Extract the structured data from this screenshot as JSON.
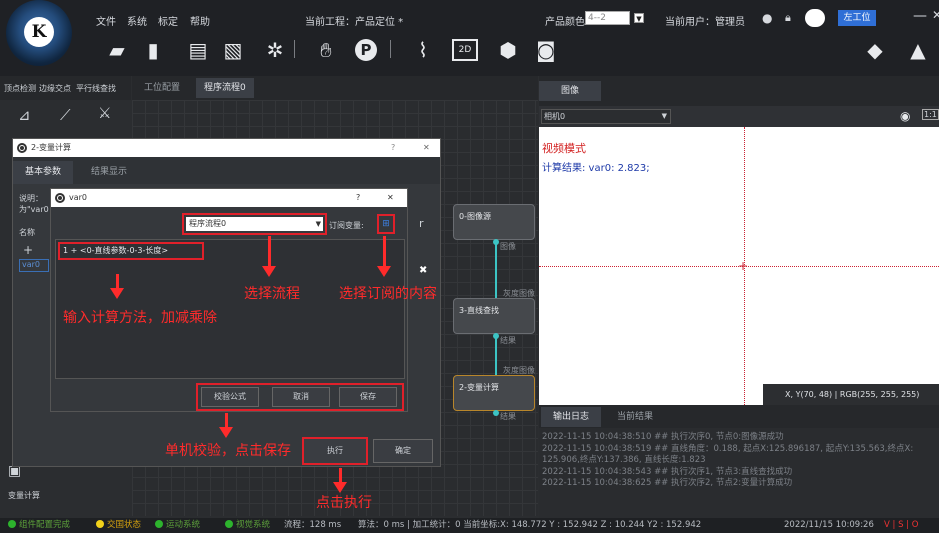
{
  "menu": {
    "file": "文件",
    "system": "系统",
    "calibrate": "标定",
    "help": "帮助",
    "project": "当前工程：产品定位 *",
    "product_color_label": "产品颜色",
    "product_color_value": "4--2",
    "user": "当前用户：管理员",
    "station": "左工位"
  },
  "left_tabs": [
    "顶点检测",
    "边缘交点",
    "平行线查找"
  ],
  "center_tabs": [
    "工位配置",
    "程序流程0"
  ],
  "image_tab": "图像",
  "camera_select": "相机0",
  "image_overlay": {
    "mode": "视频模式",
    "result": "计算结果: var0: 2.823;"
  },
  "coord_readout": "X, Y(70, 48)  |  RGB(255, 255, 255)",
  "log_tabs": [
    "输出日志",
    "当前结果"
  ],
  "log_lines": [
    "2022-11-15 10:04:38:510 ## 执行次序0, 节点0:图像源成功",
    "2022-11-15 10:04:38:519 ## 直线角度：0.188, 起点X:125.896187, 起点Y:135.563,终点X:",
    "125.906,终点Y:137.386, 直线长度:1.823",
    "2022-11-15 10:04:38:543 ## 执行次序1, 节点3:直线查找成功",
    "2022-11-15 10:04:38:625 ## 执行次序2, 节点2:变量计算成功"
  ],
  "nodes": {
    "n0": "0-图像源",
    "n0_port": "图像",
    "n3_in": "灰度图像",
    "n3": "3-直线查找",
    "n3_port": "结果",
    "n2_in": "灰度图像",
    "n2": "2-变量计算",
    "n2_port": "结果"
  },
  "side": {
    "var_calc": "变量计算"
  },
  "dlg1": {
    "title": "2-变量计算",
    "help": "?",
    "close": "✕",
    "tab_basic": "基本参数",
    "tab_result": "结果显示",
    "desc_label": "说明：",
    "name_label": "名称",
    "add": "+",
    "var_item": "var0",
    "execute": "执行",
    "confirm": "确定",
    "trunc": "为\"var0",
    "frag": "r"
  },
  "dlg2": {
    "title": "var0",
    "help": "?",
    "close": "✕",
    "flow_select": "程序流程0",
    "subscribe_label": "订阅变量:",
    "expr": "1 + <0-直线参数-0-3-长度>",
    "verify": "校验公式",
    "cancel": "取消",
    "save": "保存"
  },
  "annotations": {
    "a1": "输入计算方法，加减乘除",
    "a2": "选择流程",
    "a3": "选择订阅的内容",
    "a4": "单机校验，点击保存",
    "a5": "点击执行"
  },
  "status": {
    "s1": "组件配置完成",
    "s2": "交国状态",
    "s3": "运动系统",
    "s4": "视觉系统",
    "s5": "流程：128 ms",
    "s6": "算法：0 ms | 加工统计：0  当前坐标:X: 148.772  Y : 152.942  Z : 10.244  Y2 : 152.942",
    "time": "2022/11/15 10:09:26",
    "tail": "V | S | O"
  },
  "colors": {
    "accent_red": "#e0202a",
    "bg": "#2b2d30",
    "link_teal": "#3cc4c4"
  }
}
